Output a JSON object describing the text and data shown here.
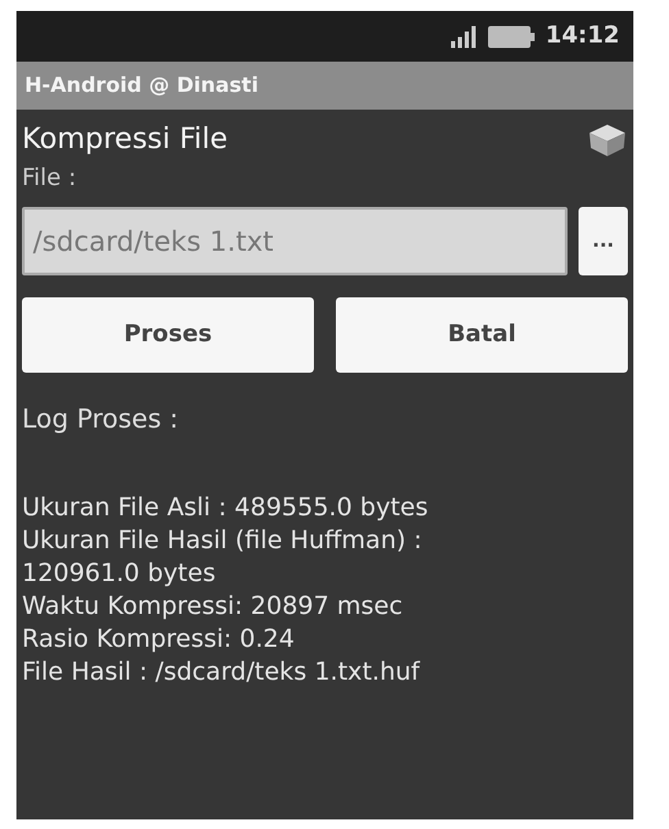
{
  "status_bar": {
    "time": "14:12"
  },
  "title_bar": {
    "title": "H-Android @ Dinasti"
  },
  "heading": "Kompressi File",
  "file_label": "File :",
  "file_field": {
    "value": "/sdcard/teks 1.txt"
  },
  "browse_button": "...",
  "buttons": [
    "Proses",
    "Batal"
  ],
  "log_label": "Log Proses :",
  "log_lines": [
    "Ukuran File Asli : 489555.0 bytes",
    "Ukuran File Hasil (file Huffman) :",
    "120961.0 bytes",
    "Waktu Kompressi: 20897 msec",
    "Rasio Kompressi: 0.24",
    "File Hasil : /sdcard/teks 1.txt.huf"
  ]
}
